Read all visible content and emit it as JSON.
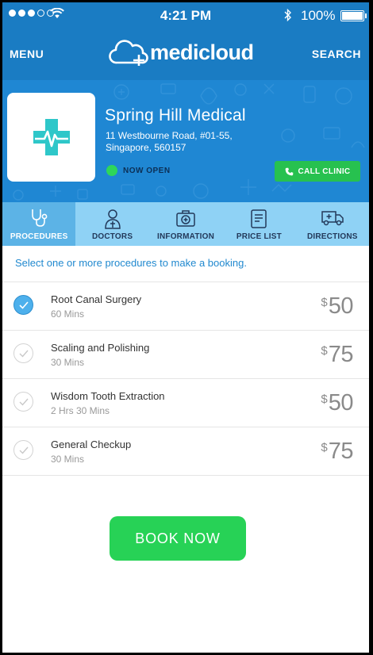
{
  "status_bar": {
    "time": "4:21 PM",
    "battery": "100%",
    "battery_level": 1.0,
    "signal_bars_filled": 3,
    "signal_bars_total": 5
  },
  "header": {
    "menu_label": "MENU",
    "search_label": "SEARCH",
    "brand_medi": "medi",
    "brand_cloud": "cloud"
  },
  "clinic": {
    "name": "Spring Hill Medical",
    "address_line1": "11 Westbourne Road, #01-55,",
    "address_line2": "Singapore, 560157",
    "status": "NOW OPEN",
    "call_label": "CALL CLINIC"
  },
  "tabs": [
    {
      "label": "PROCEDURES",
      "icon": "stethoscope-icon",
      "active": true
    },
    {
      "label": "DOCTORS",
      "icon": "doctor-icon",
      "active": false
    },
    {
      "label": "INFORMATION",
      "icon": "medical-kit-icon",
      "active": false
    },
    {
      "label": "PRICE LIST",
      "icon": "price-list-icon",
      "active": false
    },
    {
      "label": "DIRECTIONS",
      "icon": "ambulance-icon",
      "active": false
    }
  ],
  "instruction": "Select one or more procedures to make a booking.",
  "procedures": [
    {
      "name": "Root Canal Surgery",
      "duration": "60 Mins",
      "currency": "$",
      "price": "50",
      "selected": true
    },
    {
      "name": "Scaling and Polishing",
      "duration": "30 Mins",
      "currency": "$",
      "price": "75",
      "selected": false
    },
    {
      "name": "Wisdom Tooth Extraction",
      "duration": "2 Hrs 30 Mins",
      "currency": "$",
      "price": "50",
      "selected": false
    },
    {
      "name": "General Checkup",
      "duration": "30 Mins",
      "currency": "$",
      "price": "75",
      "selected": false
    }
  ],
  "book_label": "BOOK NOW",
  "colors": {
    "primary": "#1a7cc3",
    "banner": "#1f87d3",
    "tabs_bg": "#8fd2f5",
    "tab_active": "#5cb3e6",
    "accent_green": "#27d256",
    "logo_teal": "#2ec7c9"
  }
}
